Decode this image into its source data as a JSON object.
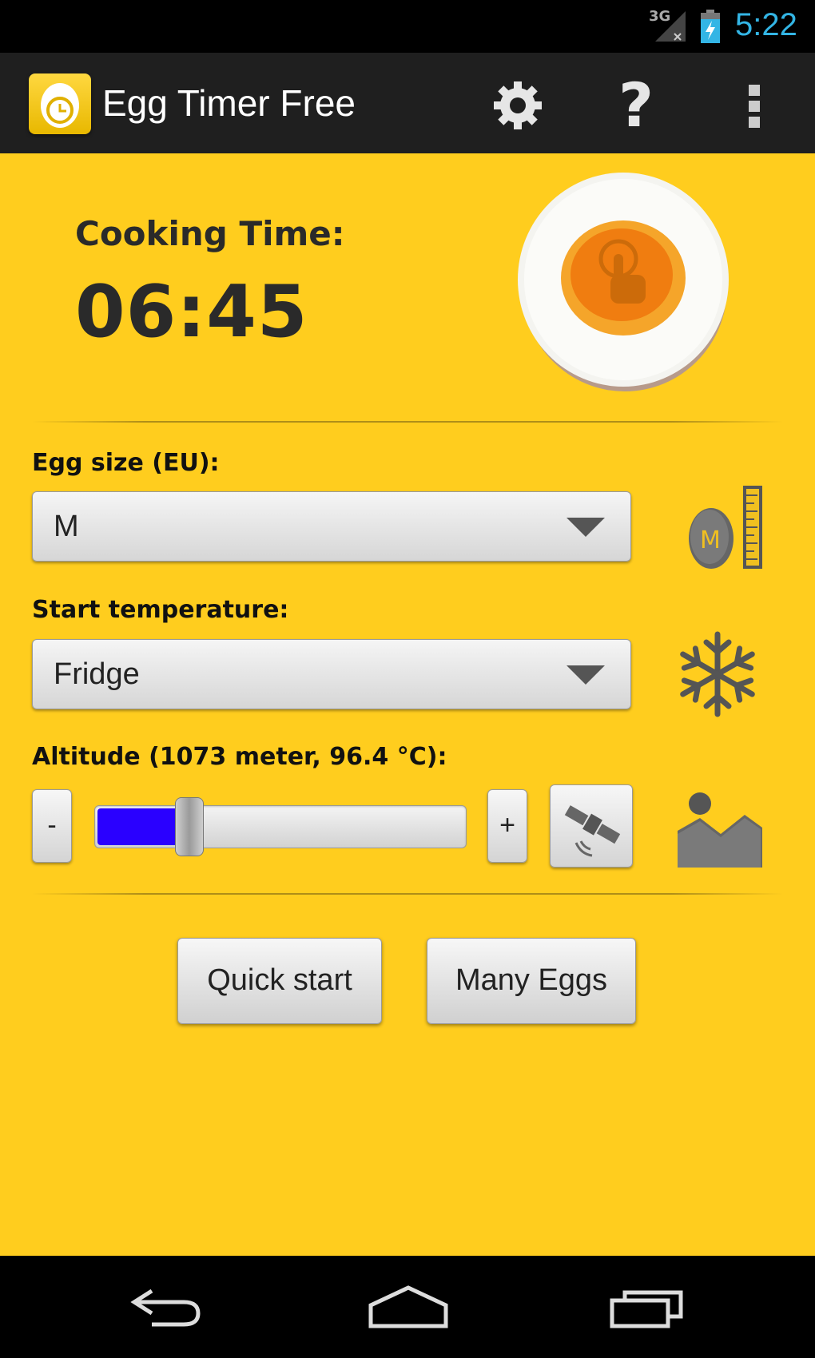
{
  "status_bar": {
    "network": "3G",
    "time": "5:22",
    "accent_color": "#33b5e5"
  },
  "action_bar": {
    "app_title": "Egg Timer Free",
    "icons": [
      "app-icon",
      "settings-icon",
      "help-icon",
      "overflow-menu-icon"
    ],
    "help_glyph": "?"
  },
  "cooking": {
    "label": "Cooking Time:",
    "time": "06:45"
  },
  "egg_size": {
    "label": "Egg size (EU):",
    "selected": "M",
    "icon_letter": "M"
  },
  "start_temperature": {
    "label": "Start temperature:",
    "selected": "Fridge"
  },
  "altitude": {
    "label": "Altitude (1073 meter, 96.4 °C):",
    "minus_label": "-",
    "plus_label": "+",
    "slider_fraction": 0.25,
    "slider_color": "#2a00ff"
  },
  "buttons": {
    "quick_start": "Quick start",
    "many_eggs": "Many Eggs"
  },
  "theme": {
    "background": "#ffcd1e",
    "action_bar": "#1f1f1f"
  }
}
